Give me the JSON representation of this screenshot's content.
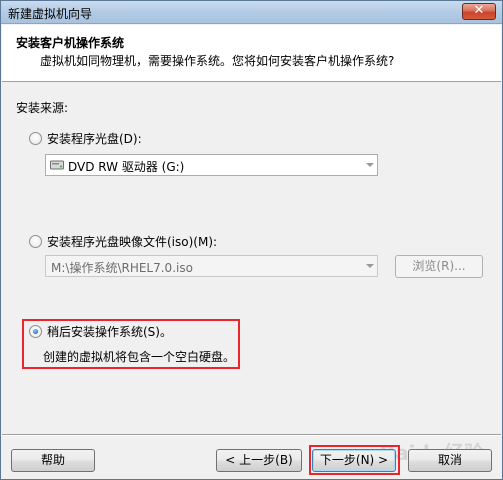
{
  "window": {
    "title": "新建虚拟机向导",
    "close_symbol": "✕"
  },
  "header": {
    "title": "安装客户机操作系统",
    "description": "虚拟机如同物理机，需要操作系统。您将如何安装客户机操作系统?"
  },
  "source": {
    "label": "安装来源:",
    "options": [
      {
        "label": "安装程序光盘(D):",
        "selected": false
      },
      {
        "label": "安装程序光盘映像文件(iso)(M):",
        "selected": false
      },
      {
        "label": "稍后安装操作系统(S)。",
        "selected": true
      }
    ],
    "disc_drive": {
      "value": "DVD RW 驱动器 (G:)",
      "icon": "dvd-drive-icon"
    },
    "iso_path": {
      "value": "M:\\操作系统\\RHEL7.0.iso"
    },
    "browse_label": "浏览(R)...",
    "later_note": "创建的虚拟机将包含一个空白硬盘。"
  },
  "footer": {
    "help_label": "帮助",
    "back_label": "< 上一步(B)",
    "next_label": "下一步(N) >",
    "cancel_label": "取消"
  },
  "colors": {
    "highlight": "#e8262c",
    "accent": "#1b6fc5"
  },
  "watermark": "Baidu经验"
}
